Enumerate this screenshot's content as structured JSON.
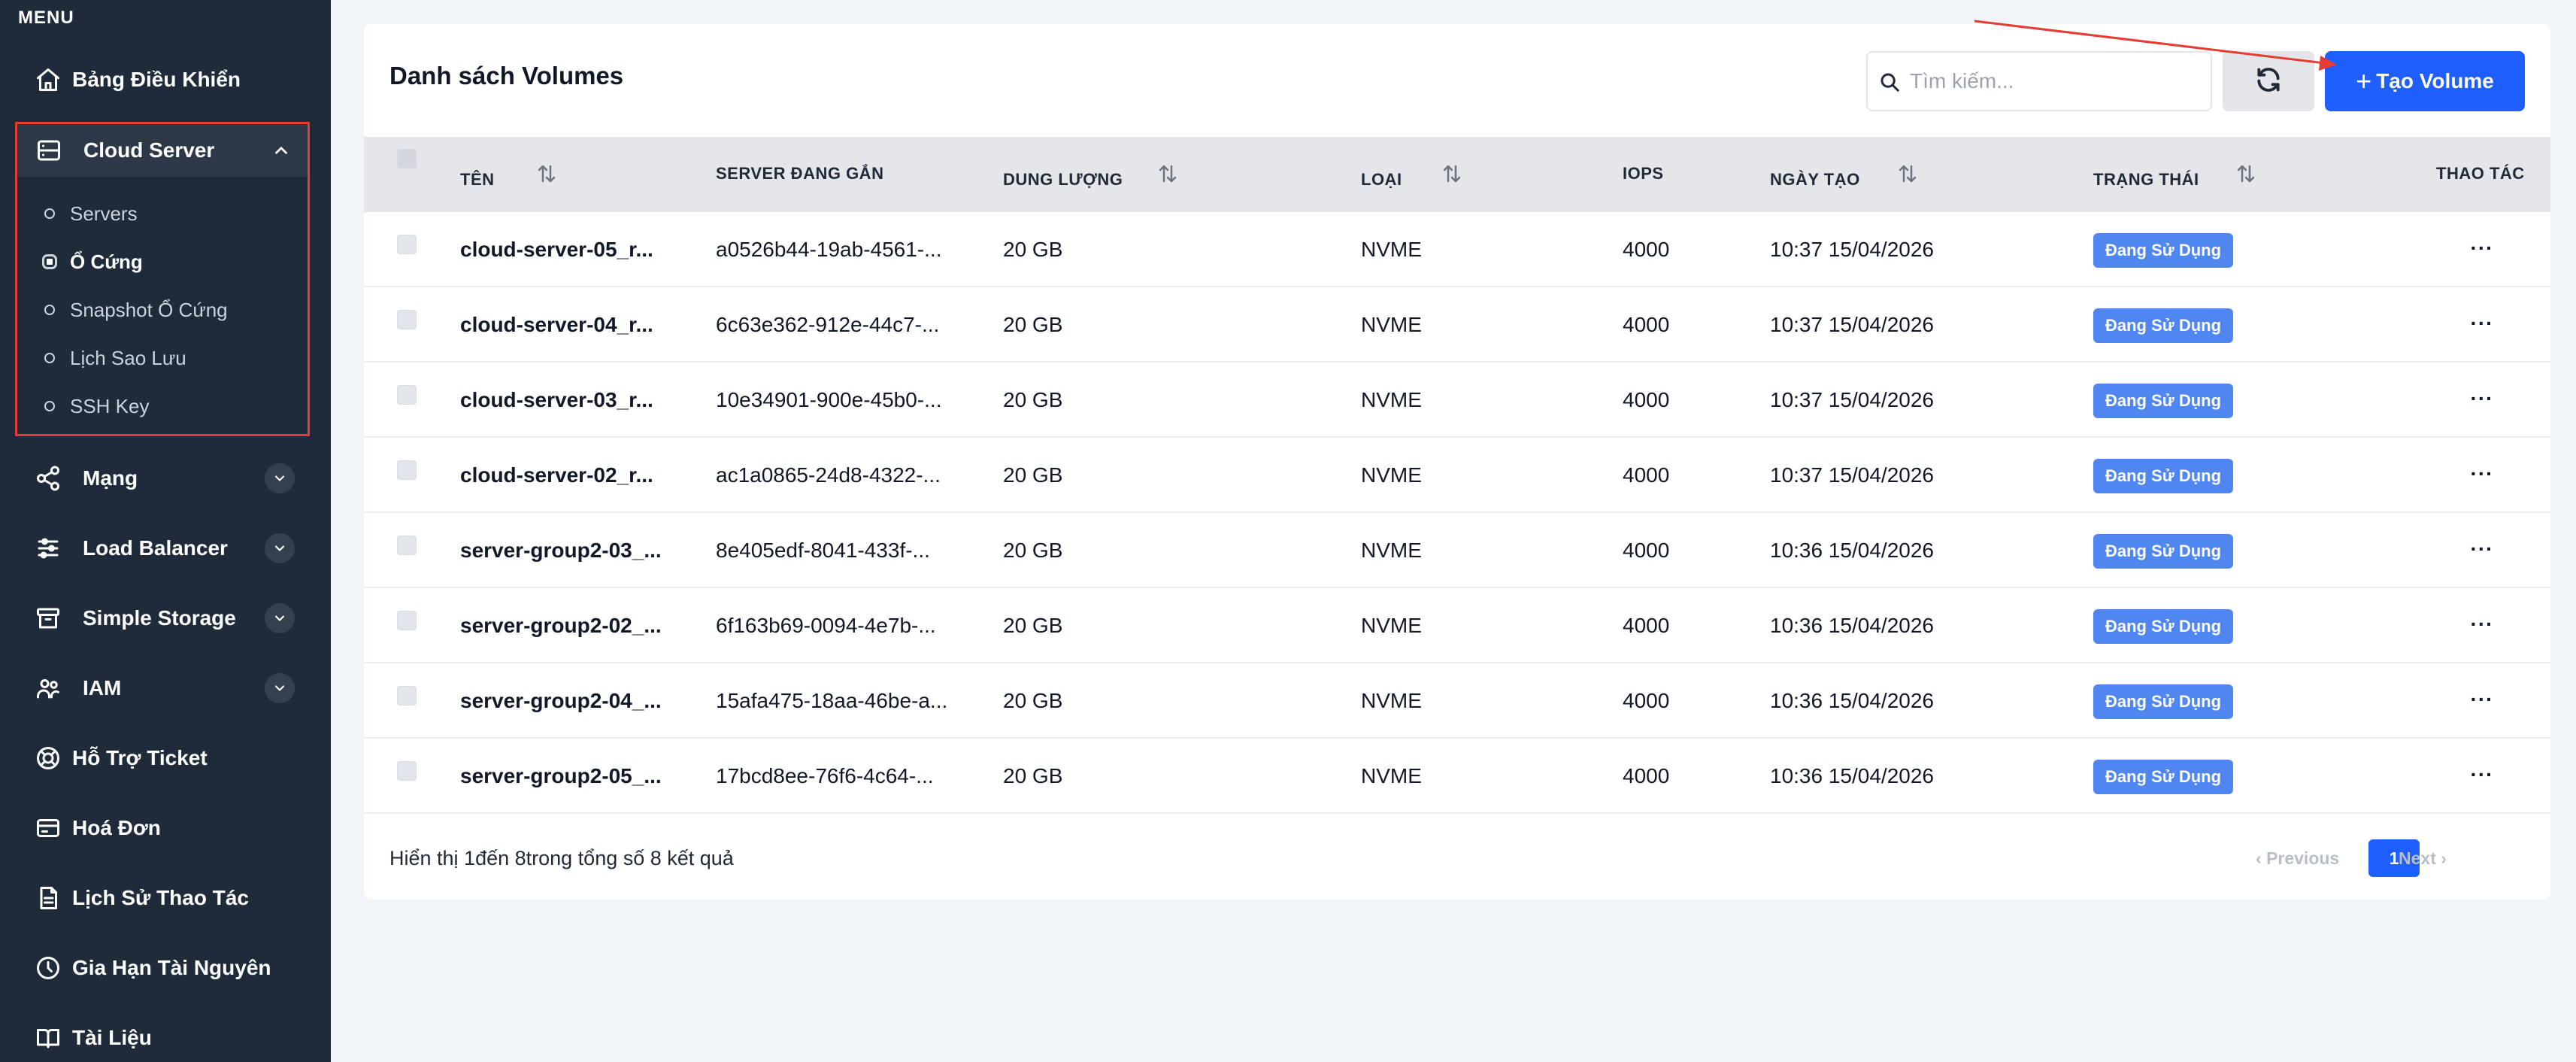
{
  "sidebar": {
    "menu_label": "MENU",
    "dashboard": "Bảng Điều Khiển",
    "cloud_server": {
      "label": "Cloud Server",
      "items": [
        "Servers",
        "Ổ Cứng",
        "Snapshot Ổ Cứng",
        "Lịch Sao Lưu",
        "SSH Key"
      ],
      "active_item": "Ổ Cứng"
    },
    "network": "Mạng",
    "load_balancer": "Load Balancer",
    "simple_storage": "Simple Storage",
    "iam": "IAM",
    "support": "Hỗ Trợ Ticket",
    "invoice": "Hoá Đơn",
    "history": "Lịch Sử Thao Tác",
    "renew": "Gia Hạn Tài Nguyên",
    "docs": "Tài Liệu"
  },
  "main": {
    "title": "Danh sách Volumes",
    "search_placeholder": "Tìm kiếm...",
    "create_button": "Tạo Volume",
    "columns": {
      "name": "TÊN",
      "server": "SERVER ĐANG GẮN",
      "capacity": "DUNG LƯỢNG",
      "type": "LOẠI",
      "iops": "IOPS",
      "created": "NGÀY TẠO",
      "status": "TRẠNG THÁI",
      "actions": "THAO TÁC"
    },
    "rows": [
      {
        "name": "cloud-server-05_r...",
        "server": "a0526b44-19ab-4561-...",
        "capacity": "20 GB",
        "type": "NVME",
        "iops": "4000",
        "created": "10:37 15/04/2026",
        "status": "Đang Sử Dụng"
      },
      {
        "name": "cloud-server-04_r...",
        "server": "6c63e362-912e-44c7-...",
        "capacity": "20 GB",
        "type": "NVME",
        "iops": "4000",
        "created": "10:37 15/04/2026",
        "status": "Đang Sử Dụng"
      },
      {
        "name": "cloud-server-03_r...",
        "server": "10e34901-900e-45b0-...",
        "capacity": "20 GB",
        "type": "NVME",
        "iops": "4000",
        "created": "10:37 15/04/2026",
        "status": "Đang Sử Dụng"
      },
      {
        "name": "cloud-server-02_r...",
        "server": "ac1a0865-24d8-4322-...",
        "capacity": "20 GB",
        "type": "NVME",
        "iops": "4000",
        "created": "10:37 15/04/2026",
        "status": "Đang Sử Dụng"
      },
      {
        "name": "server-group2-03_...",
        "server": "8e405edf-8041-433f-...",
        "capacity": "20 GB",
        "type": "NVME",
        "iops": "4000",
        "created": "10:36 15/04/2026",
        "status": "Đang Sử Dụng"
      },
      {
        "name": "server-group2-02_...",
        "server": "6f163b69-0094-4e7b-...",
        "capacity": "20 GB",
        "type": "NVME",
        "iops": "4000",
        "created": "10:36 15/04/2026",
        "status": "Đang Sử Dụng"
      },
      {
        "name": "server-group2-04_...",
        "server": "15afa475-18aa-46be-a...",
        "capacity": "20 GB",
        "type": "NVME",
        "iops": "4000",
        "created": "10:36 15/04/2026",
        "status": "Đang Sử Dụng"
      },
      {
        "name": "server-group2-05_...",
        "server": "17bcd8ee-76f6-4c64-...",
        "capacity": "20 GB",
        "type": "NVME",
        "iops": "4000",
        "created": "10:36 15/04/2026",
        "status": "Đang Sử Dụng"
      }
    ],
    "more_label": "···",
    "footer": "Hiển thị 1đến 8trong tổng số 8 kết quả",
    "pagination": {
      "previous": "Previous",
      "page": "1",
      "next": "Next"
    }
  },
  "colors": {
    "sidebar_bg": "#1f2a3a",
    "primary": "#1f5eff",
    "status_badge": "#4f86f0",
    "highlight_border": "#e53d35"
  }
}
